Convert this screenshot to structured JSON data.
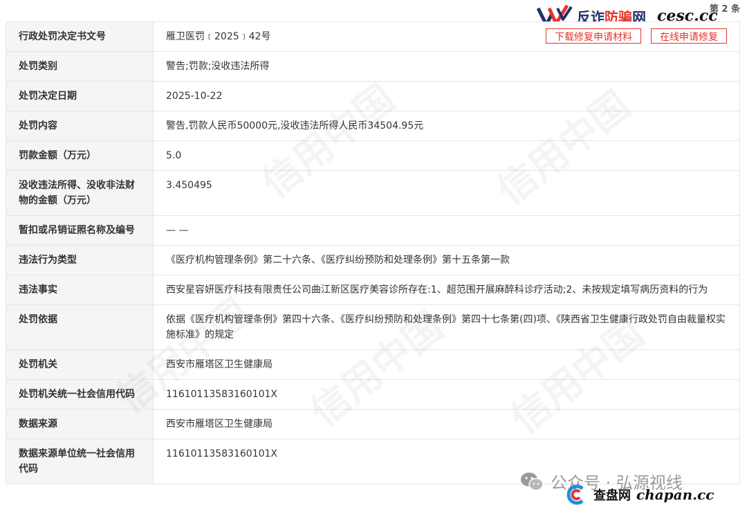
{
  "header": {
    "page_label": "第 2 条",
    "brand_cn_prefix": "反诈",
    "brand_cn_accent": "防骗",
    "brand_cn_suffix": "网",
    "brand_domain": "cesc.cc"
  },
  "buttons": {
    "download": "下载修复申请材料",
    "online_repair": "在线申请修复"
  },
  "rows": [
    {
      "key": "行政处罚决定书文号",
      "value": "雁卫医罚﹝2025﹞42号"
    },
    {
      "key": "处罚类别",
      "value": "警告;罚款;没收违法所得"
    },
    {
      "key": "处罚决定日期",
      "value": "2025-10-22"
    },
    {
      "key": "处罚内容",
      "value": "警告,罚款人民币50000元,没收违法所得人民币34504.95元"
    },
    {
      "key": "罚款金额（万元）",
      "value": "5.0"
    },
    {
      "key": "没收违法所得、没收非法财物的金额（万元）",
      "value": "3.450495"
    },
    {
      "key": "暂扣或吊销证照名称及编号",
      "value": "— —"
    },
    {
      "key": "违法行为类型",
      "value": "《医疗机构管理条例》第二十六条、《医疗纠纷预防和处理条例》第十五条第一款"
    },
    {
      "key": "违法事实",
      "value": "西安星容妍医疗科技有限责任公司曲江新区医疗美容诊所存在:1、超范围开展麻醉科诊疗活动;2、未按规定填写病历资料的行为"
    },
    {
      "key": "处罚依据",
      "value": "依据《医疗机构管理条例》第四十六条、《医疗纠纷预防和处理条例》第四十七条第(四)项、《陕西省卫生健康行政处罚自由裁量权实施标准》的规定"
    },
    {
      "key": "处罚机关",
      "value": "西安市雁塔区卫生健康局"
    },
    {
      "key": "处罚机关统一社会信用代码",
      "value": "11610113583160101X"
    },
    {
      "key": "数据来源",
      "value": "西安市雁塔区卫生健康局"
    },
    {
      "key": "数据来源单位统一社会信用代码",
      "value": "11610113583160101X"
    }
  ],
  "footer": {
    "wechat_text": "公众号 · 弘源视线",
    "brand_cn": "查盘网",
    "brand_domain": "chapan.cc"
  },
  "colors": {
    "accent_red": "#e5342a",
    "brand_navy": "#1f2f6b",
    "key_bg": "#f5f5f5"
  }
}
